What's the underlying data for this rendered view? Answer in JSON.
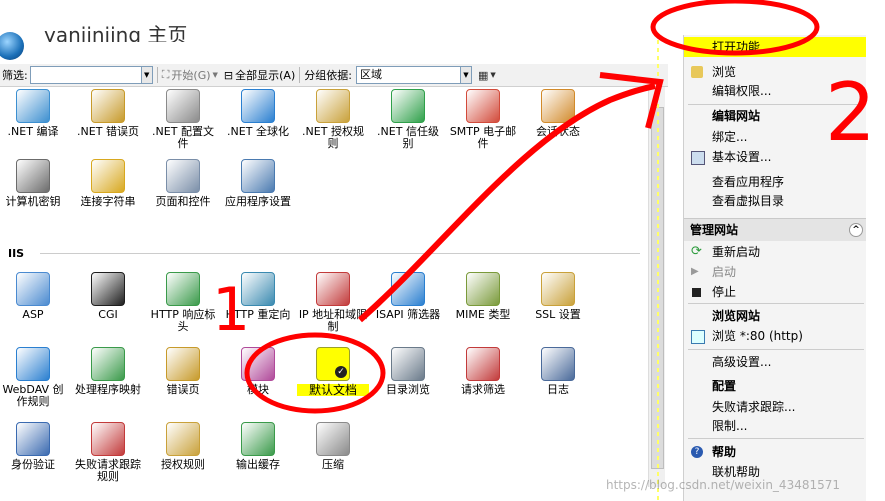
{
  "header": {
    "title": "yanjinjing 主页"
  },
  "filter": {
    "label": "筛选:",
    "start_label": "开始(G)",
    "show_all_label": "全部显示(A)",
    "group_label": "分组依据:",
    "group_value": "区域"
  },
  "section_iis": "IIS",
  "grid_row1": [
    {
      "label": ".NET 编译",
      "icon": "package-icon",
      "color": "#3c8fd0"
    },
    {
      "label": ".NET 错误页",
      "icon": "error-404-icon",
      "color": "#c79a2a"
    },
    {
      "label": ".NET 配置文件",
      "icon": "config-file-icon",
      "color": "#8a8a8a"
    },
    {
      "label": ".NET 全球化",
      "icon": "globe-icon",
      "color": "#2a7fd0"
    },
    {
      "label": ".NET 授权规则",
      "icon": "auth-rules-icon",
      "color": "#c9a13a"
    },
    {
      "label": ".NET 信任级别",
      "icon": "trust-level-icon",
      "color": "#2fa04a"
    },
    {
      "label": "SMTP 电子邮件",
      "icon": "email-icon",
      "color": "#d24a3a"
    },
    {
      "label": "会话状态",
      "icon": "session-icon",
      "color": "#d28a2a"
    }
  ],
  "grid_row2": [
    {
      "label": "计算机密钥",
      "icon": "machine-key-icon",
      "color": "#6b6b6b"
    },
    {
      "label": "连接字符串",
      "icon": "connection-string-icon",
      "color": "#d8a81f"
    },
    {
      "label": "页面和控件",
      "icon": "pages-controls-icon",
      "color": "#7a8ea8"
    },
    {
      "label": "应用程序设置",
      "icon": "app-settings-icon",
      "color": "#4a7ab0"
    }
  ],
  "grid_row3": [
    {
      "label": "ASP",
      "icon": "asp-icon",
      "color": "#4a8ad0"
    },
    {
      "label": "CGI",
      "icon": "cgi-icon",
      "color": "#1e1e1e"
    },
    {
      "label": "HTTP 响应标头",
      "icon": "http-headers-icon",
      "color": "#3a9a4a"
    },
    {
      "label": "HTTP 重定向",
      "icon": "http-redirect-icon",
      "color": "#3a8ab0"
    },
    {
      "label": "IP 地址和域限制",
      "icon": "ip-restrict-icon",
      "color": "#c23a3a"
    },
    {
      "label": "ISAPI 筛选器",
      "icon": "isapi-icon",
      "color": "#2a7fd0"
    },
    {
      "label": "MIME 类型",
      "icon": "mime-icon",
      "color": "#7a9a3a"
    },
    {
      "label": "SSL 设置",
      "icon": "lock-icon",
      "color": "#c9a13a"
    }
  ],
  "grid_row4": [
    {
      "label": "WebDAV 创作规则",
      "icon": "webdav-icon",
      "color": "#2a7fd0"
    },
    {
      "label": "处理程序映射",
      "icon": "handler-mapping-icon",
      "color": "#3a9a4a"
    },
    {
      "label": "错误页",
      "icon": "error-page-icon",
      "color": "#c79a2a"
    },
    {
      "label": "模块",
      "icon": "modules-icon",
      "color": "#b04a9a"
    },
    {
      "label": "默认文档",
      "icon": "default-document-icon",
      "color": "#9aa02a"
    },
    {
      "label": "目录浏览",
      "icon": "directory-browse-icon",
      "color": "#6a7a8a"
    },
    {
      "label": "请求筛选",
      "icon": "request-filter-icon",
      "color": "#c23a3a"
    },
    {
      "label": "日志",
      "icon": "log-icon",
      "color": "#4a6a9a"
    }
  ],
  "grid_row5": [
    {
      "label": "身份验证",
      "icon": "authentication-icon",
      "color": "#3a6ab0"
    },
    {
      "label": "失败请求跟踪规则",
      "icon": "failed-request-icon",
      "color": "#c23a3a"
    },
    {
      "label": "授权规则",
      "icon": "authorization-icon",
      "color": "#c9a13a"
    },
    {
      "label": "输出缓存",
      "icon": "output-cache-icon",
      "color": "#3a9a4a"
    },
    {
      "label": "压缩",
      "icon": "compression-icon",
      "color": "#8a8a8a"
    }
  ],
  "actions": {
    "open_feature": "打开功能",
    "browse": "浏览",
    "edit_permissions": "编辑权限...",
    "edit_site": "编辑网站",
    "bindings": "绑定...",
    "basic_settings": "基本设置...",
    "view_apps": "查看应用程序",
    "view_vdirs": "查看虚拟目录",
    "manage_site": "管理网站",
    "restart": "重新启动",
    "start": "启动",
    "stop": "停止",
    "browse_site": "浏览网站",
    "browse_80": "浏览 *:80 (http)",
    "advanced_settings": "高级设置...",
    "config": "配置",
    "failed_request_tracing": "失败请求跟踪...",
    "limits": "限制...",
    "help": "帮助",
    "online_help": "联机帮助"
  },
  "annotations": {
    "one": "1",
    "two": "2"
  },
  "watermark": "https://blog.csdn.net/weixin_43481571"
}
